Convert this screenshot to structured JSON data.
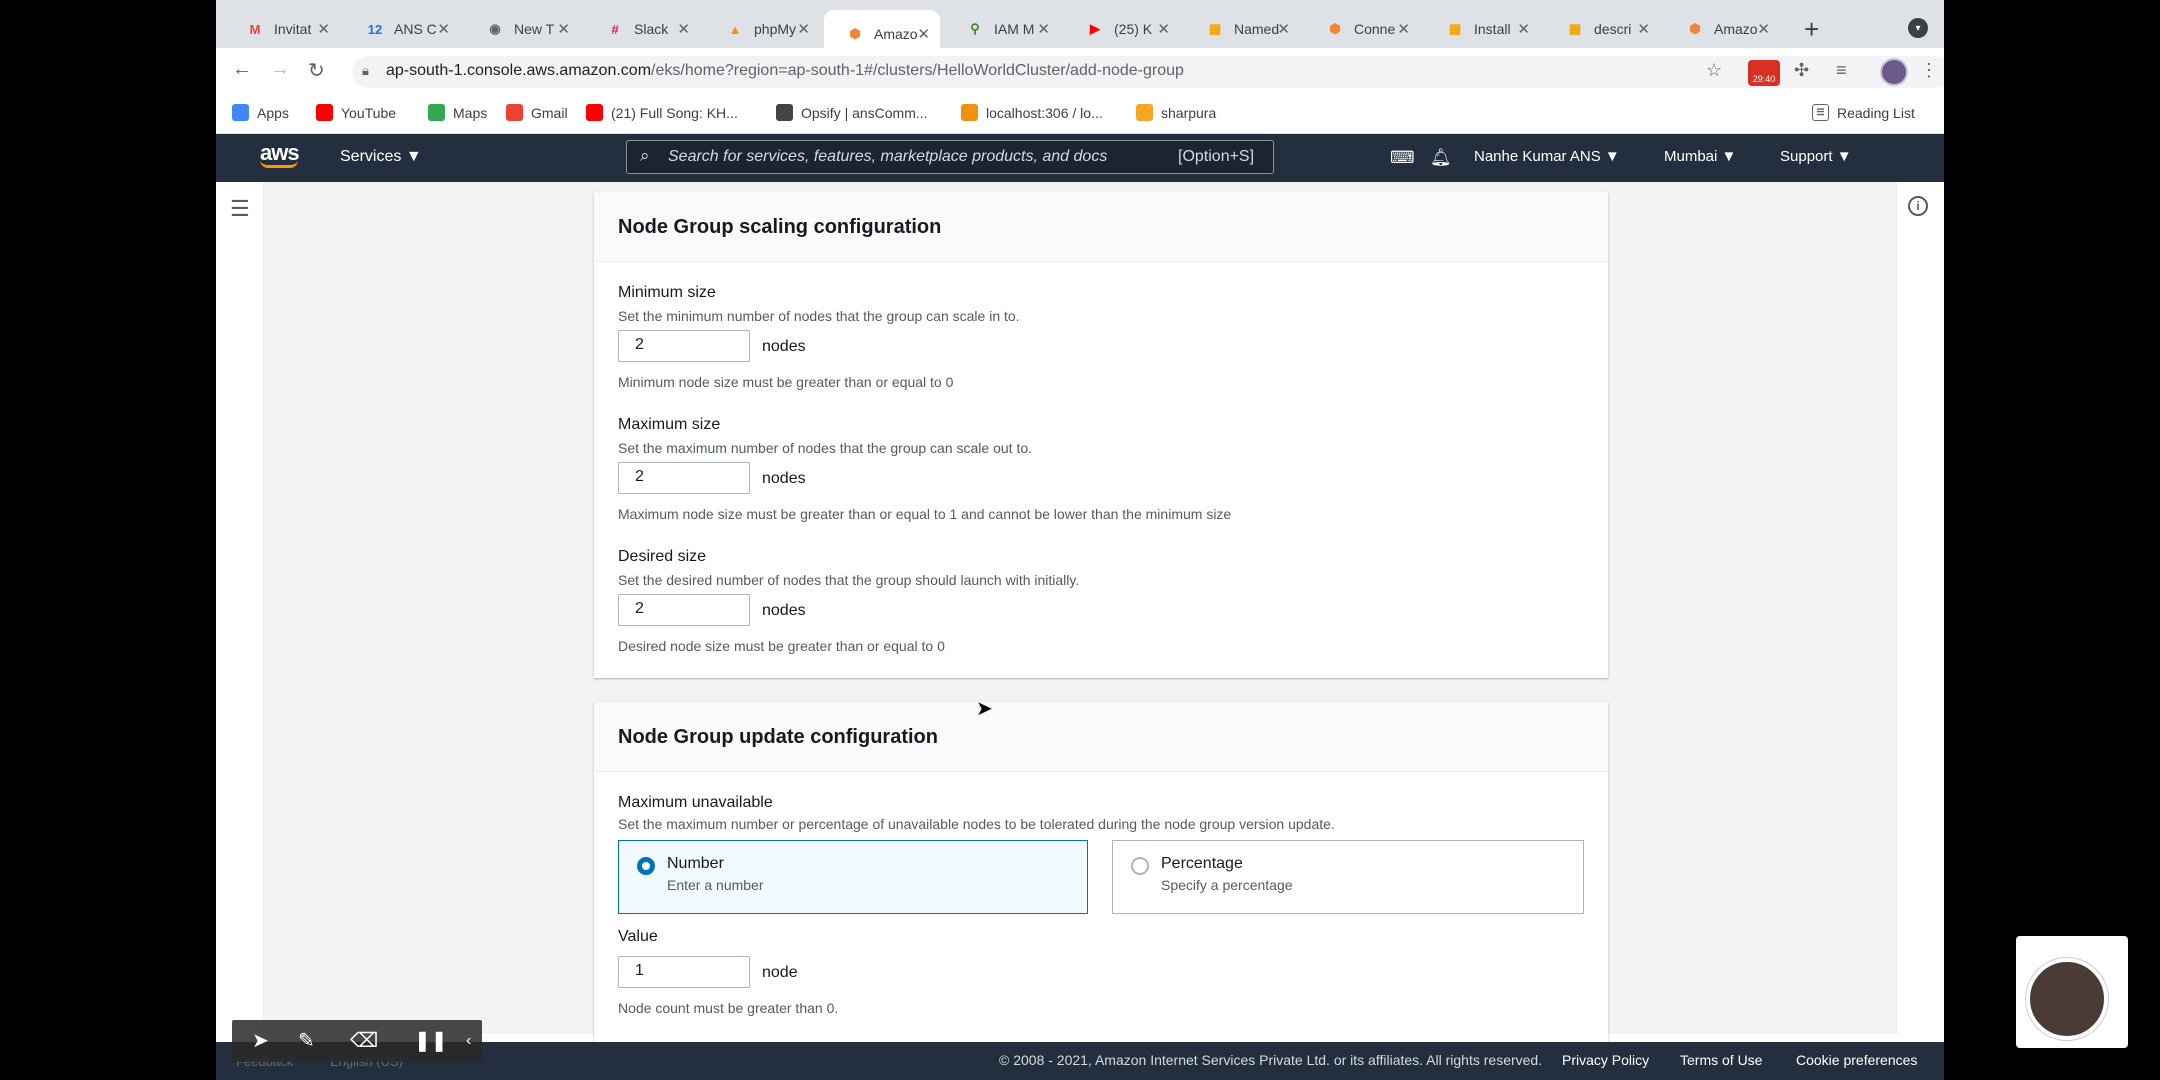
{
  "browser": {
    "tabs": [
      {
        "title": "Invitat",
        "icon": "gmail-icon",
        "color": "#ea4335",
        "glyph": "M"
      },
      {
        "title": "ANS C",
        "icon": "calendar-icon",
        "color": "#1a73e8",
        "glyph": "12"
      },
      {
        "title": "New T",
        "icon": "chrome-icon",
        "color": "#5f6368",
        "glyph": "◉"
      },
      {
        "title": "Slack",
        "icon": "slack-icon",
        "color": "#e01e5a",
        "glyph": "#"
      },
      {
        "title": "phpMy",
        "icon": "phpmyadmin-icon",
        "color": "#f29111",
        "glyph": "▲"
      },
      {
        "title": "Amazo",
        "icon": "aws-cube-icon",
        "color": "#f58536",
        "glyph": "⬢",
        "active": true
      },
      {
        "title": "IAM M",
        "icon": "key-icon",
        "color": "#3f8624",
        "glyph": "⚲"
      },
      {
        "title": "(25) K",
        "icon": "youtube-icon",
        "color": "#ff0000",
        "glyph": "▶"
      },
      {
        "title": "Named",
        "icon": "docs-icon",
        "color": "#f0a30a",
        "glyph": "▦"
      },
      {
        "title": "Conne",
        "icon": "aws-cube-icon",
        "color": "#f58536",
        "glyph": "⬢"
      },
      {
        "title": "Install",
        "icon": "docs-icon",
        "color": "#f0a30a",
        "glyph": "▦"
      },
      {
        "title": "descri",
        "icon": "docs-icon",
        "color": "#f0a30a",
        "glyph": "▦"
      },
      {
        "title": "Amazo",
        "icon": "aws-cube-icon",
        "color": "#f58536",
        "glyph": "⬢"
      }
    ],
    "url_host": "ap-south-1.console.aws.amazon.com",
    "url_path": "/eks/home?region=ap-south-1#/clusters/HelloWorldCluster/add-node-group",
    "recording_badge": "29:40",
    "bookmarks": [
      {
        "label": "Apps",
        "icon": "apps-grid-icon",
        "color": "#4285f4"
      },
      {
        "label": "YouTube",
        "icon": "youtube-icon",
        "color": "#ff0000"
      },
      {
        "label": "Maps",
        "icon": "maps-icon",
        "color": "#34a853"
      },
      {
        "label": "Gmail",
        "icon": "gmail-icon",
        "color": "#ea4335"
      },
      {
        "label": "(21) Full Song: KH...",
        "icon": "youtube-icon",
        "color": "#ff0000"
      },
      {
        "label": "Opsify | ansComm...",
        "icon": "opsify-icon",
        "color": "#444444"
      },
      {
        "label": "localhost:306 / lo...",
        "icon": "phpmyadmin-icon",
        "color": "#f29111"
      },
      {
        "label": "sharpura",
        "icon": "sharpura-icon",
        "color": "#f5a623"
      }
    ],
    "reading_list": "Reading List"
  },
  "aws_nav": {
    "logo": "aws",
    "services": "Services",
    "search_placeholder": "Search for services, features, marketplace products, and docs",
    "search_shortcut": "[Option+S]",
    "user": "Nanhe Kumar ANS",
    "region": "Mumbai",
    "support": "Support"
  },
  "scaling": {
    "title": "Node Group scaling configuration",
    "min": {
      "label": "Minimum size",
      "desc": "Set the minimum number of nodes that the group can scale in to.",
      "value": "2",
      "unit": "nodes",
      "hint": "Minimum node size must be greater than or equal to 0"
    },
    "max": {
      "label": "Maximum size",
      "desc": "Set the maximum number of nodes that the group can scale out to.",
      "value": "2",
      "unit": "nodes",
      "hint": "Maximum node size must be greater than or equal to 1 and cannot be lower than the minimum size"
    },
    "desired": {
      "label": "Desired size",
      "desc": "Set the desired number of nodes that the group should launch with initially.",
      "value": "2",
      "unit": "nodes",
      "hint": "Desired node size must be greater than or equal to 0"
    }
  },
  "update": {
    "title": "Node Group update configuration",
    "max_unavailable_label": "Maximum unavailable",
    "max_unavailable_desc": "Set the maximum number or percentage of unavailable nodes to be tolerated during the node group version update.",
    "options": [
      {
        "title": "Number",
        "sub": "Enter a number",
        "selected": true
      },
      {
        "title": "Percentage",
        "sub": "Specify a percentage",
        "selected": false
      }
    ],
    "value_label": "Value",
    "value": "1",
    "value_unit": "node",
    "value_hint": "Node count must be greater than 0."
  },
  "footer": {
    "copyright": "© 2008 - 2021, Amazon Internet Services Private Ltd. or its affiliates. All rights reserved.",
    "links": [
      "Privacy Policy",
      "Terms of Use",
      "Cookie preferences"
    ],
    "feedback": "Feedback",
    "language": "English (US)"
  },
  "colors": {
    "aws_nav_bg": "#232f3e",
    "aws_orange": "#ff9900",
    "selected_blue": "#0073bb"
  }
}
